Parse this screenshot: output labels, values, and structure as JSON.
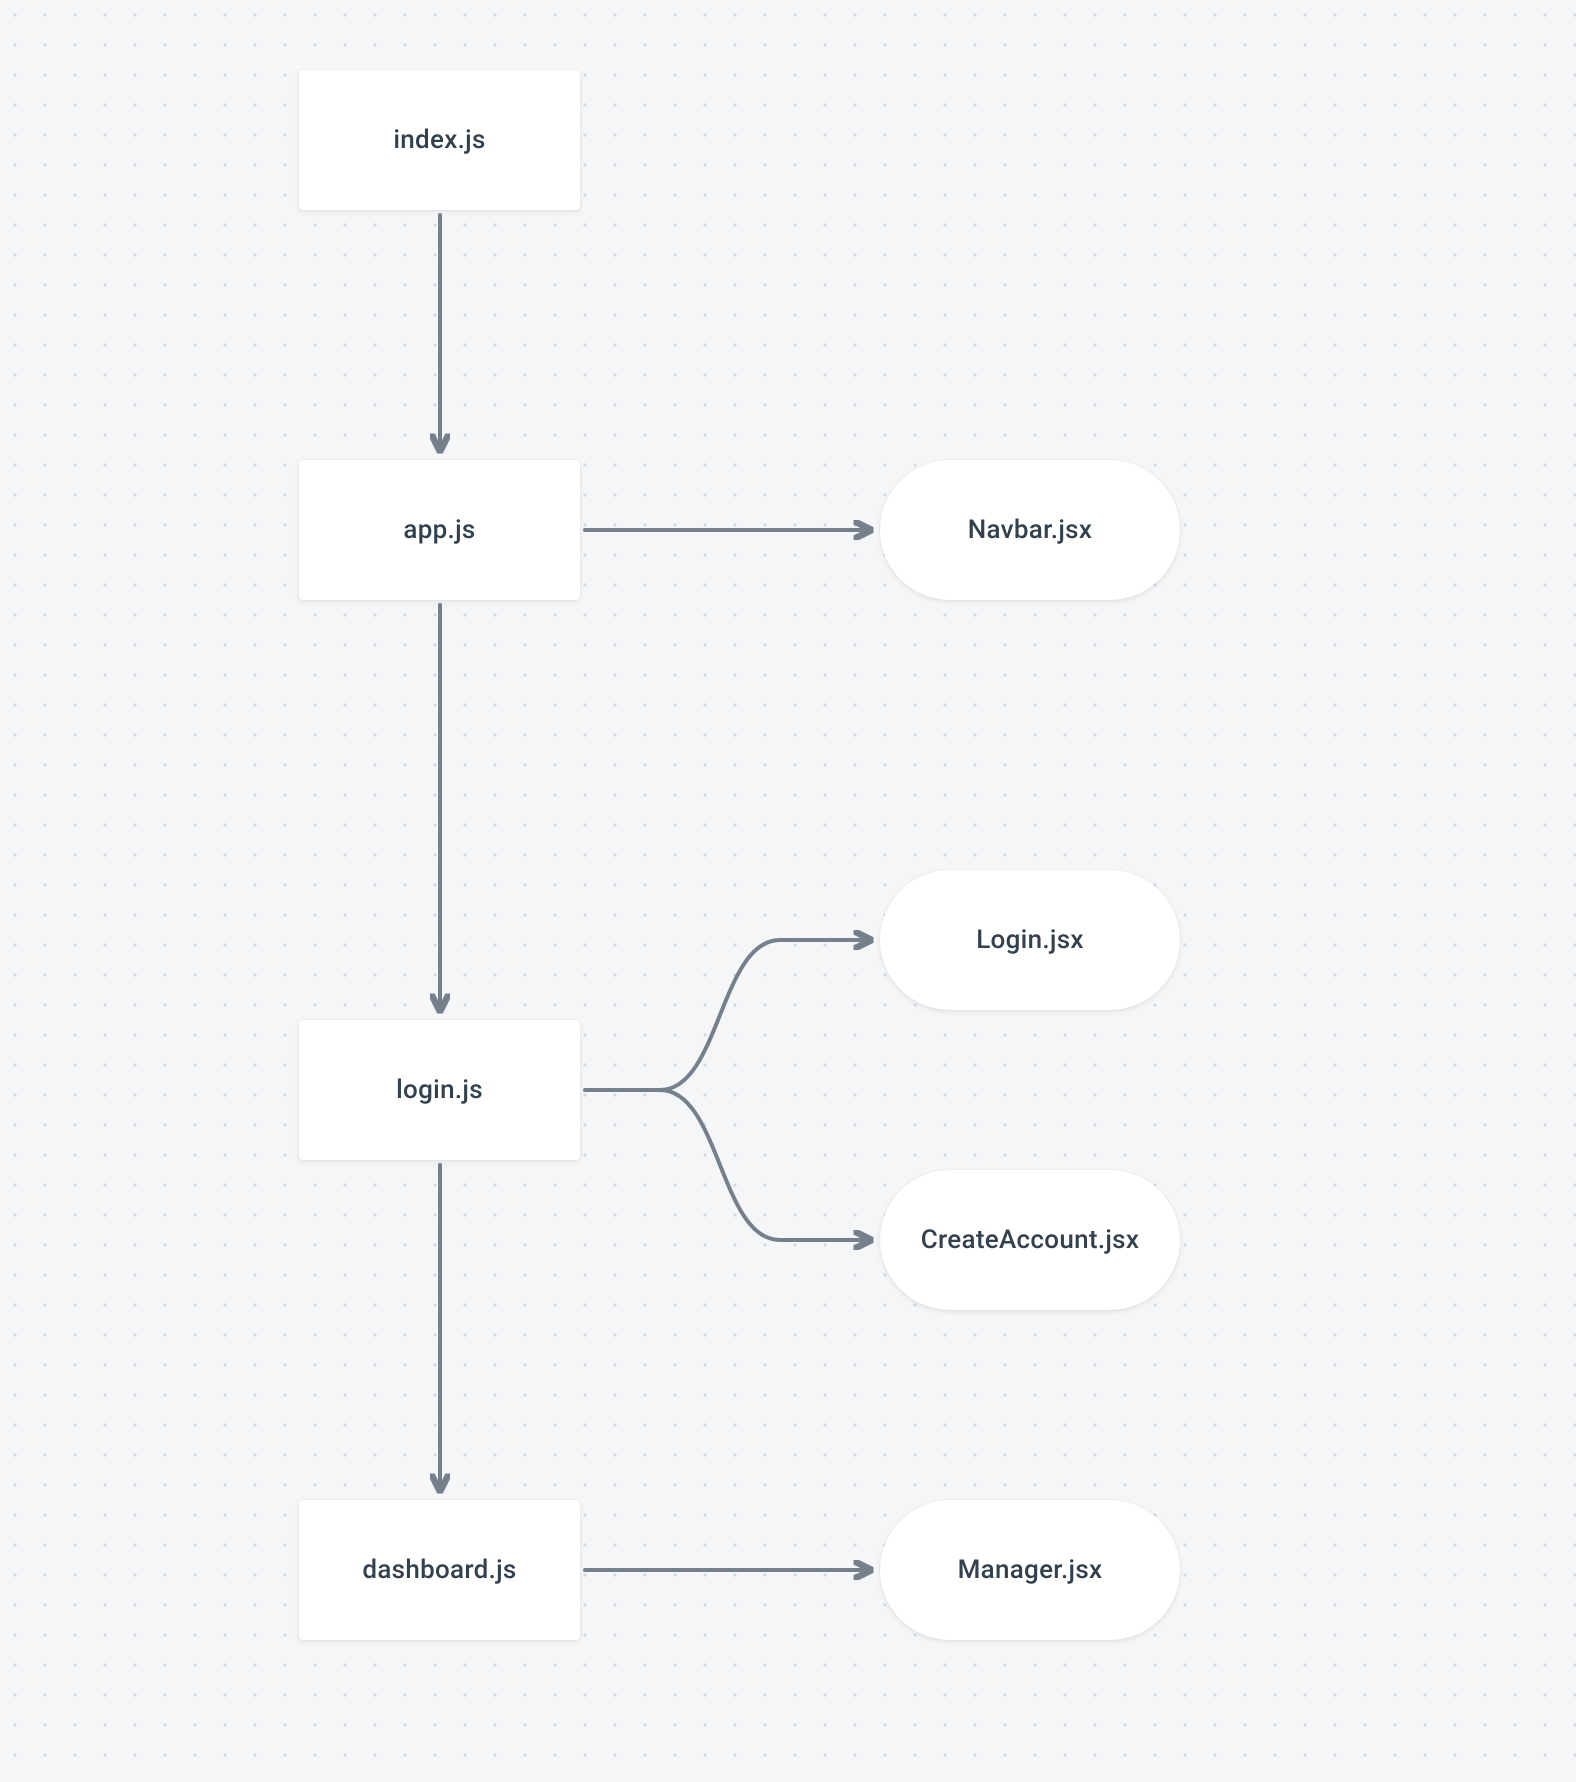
{
  "diagram": {
    "nodes": {
      "index": {
        "label": "index.js"
      },
      "app": {
        "label": "app.js"
      },
      "login": {
        "label": "login.js"
      },
      "dashboard": {
        "label": "dashboard.js"
      },
      "navbar": {
        "label": "Navbar.jsx"
      },
      "loginjsx": {
        "label": "Login.jsx"
      },
      "create": {
        "label": "CreateAccount.jsx"
      },
      "manager": {
        "label": "Manager.jsx"
      }
    },
    "edges": [
      {
        "from": "index",
        "to": "app"
      },
      {
        "from": "app",
        "to": "login"
      },
      {
        "from": "app",
        "to": "navbar"
      },
      {
        "from": "login",
        "to": "dashboard"
      },
      {
        "from": "login",
        "to": "loginjsx"
      },
      {
        "from": "login",
        "to": "create"
      },
      {
        "from": "dashboard",
        "to": "manager"
      }
    ],
    "colors": {
      "background": "#f4f6f8",
      "dot": "#d3d8df",
      "nodeBg": "#ffffff",
      "text": "#33414f",
      "edge": "#76808d"
    }
  }
}
